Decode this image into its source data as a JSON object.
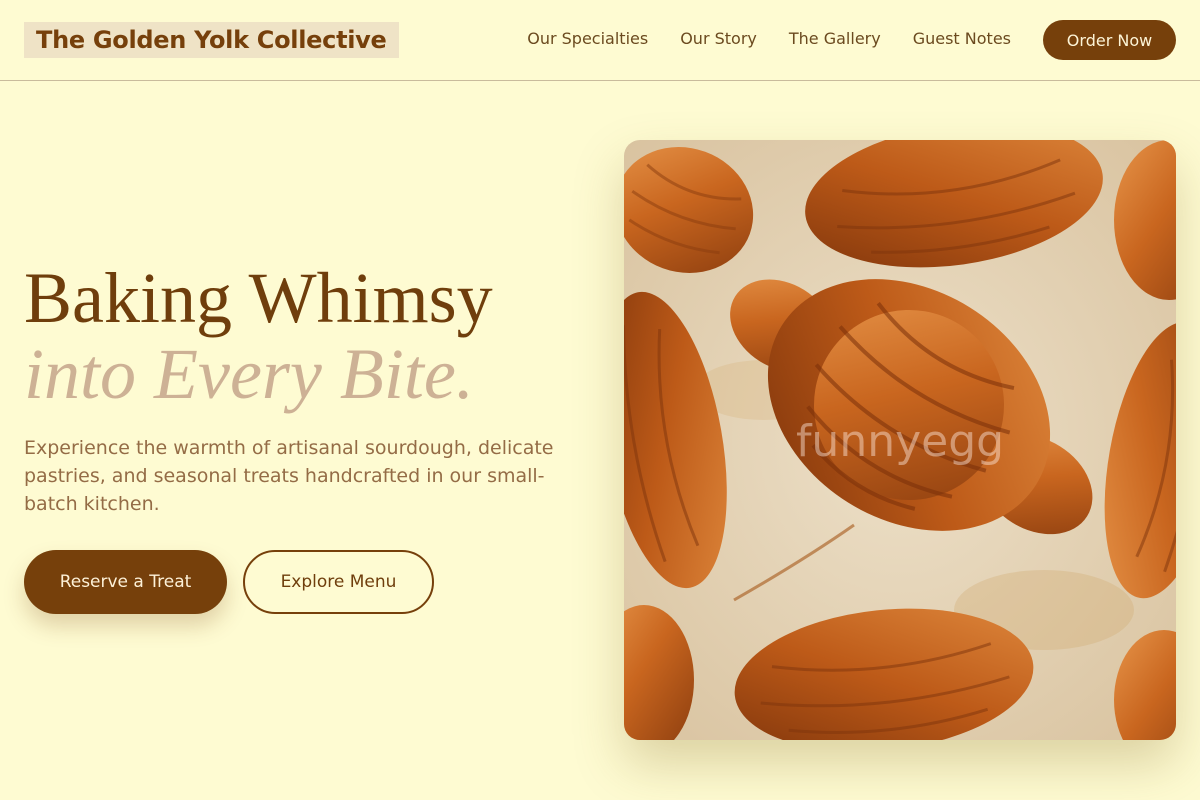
{
  "brand": {
    "name": "The Golden Yolk Collective"
  },
  "nav": {
    "items": [
      {
        "label": "Our Specialties"
      },
      {
        "label": "Our Story"
      },
      {
        "label": "The Gallery"
      },
      {
        "label": "Guest Notes"
      }
    ],
    "cta_label": "Order Now"
  },
  "hero": {
    "headline": "Baking Whimsy",
    "headline_emphasis": "into Every Bite.",
    "description": "Experience the warmth of artisanal sourdough, delicate pastries, and seasonal treats handcrafted in our small-batch kitchen.",
    "primary_button": "Reserve a Treat",
    "secondary_button": "Explore Menu",
    "image": {
      "subject": "croissants on baking paper",
      "watermark_text": "funnyegg"
    }
  },
  "colors": {
    "background": "#fefbd2",
    "brand_brown": "#76400b",
    "muted_tan": "#cdb195",
    "body_text": "#946c46"
  }
}
